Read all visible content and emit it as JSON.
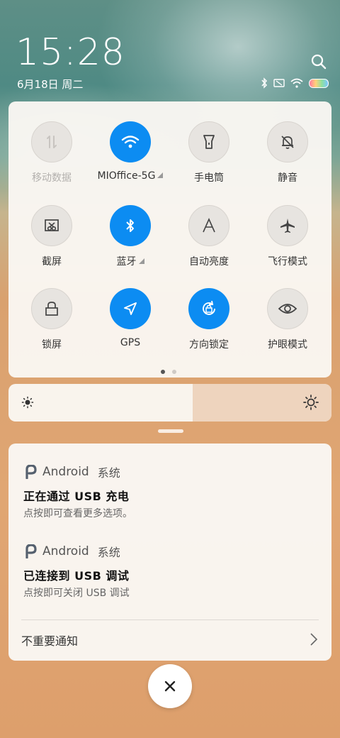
{
  "status": {
    "time": "15:28",
    "date": "6月18日 周二"
  },
  "tiles": [
    {
      "label": "移动数据",
      "icon": "mobile-data-icon",
      "on": false
    },
    {
      "label": "MIOffice-5G",
      "icon": "wifi-icon",
      "on": true
    },
    {
      "label": "手电筒",
      "icon": "flashlight-icon",
      "on": false
    },
    {
      "label": "静音",
      "icon": "mute-bell-icon",
      "on": false
    },
    {
      "label": "截屏",
      "icon": "screenshot-icon",
      "on": false
    },
    {
      "label": "蓝牙",
      "icon": "bluetooth-icon",
      "on": true
    },
    {
      "label": "自动亮度",
      "icon": "auto-brightness-icon",
      "on": false
    },
    {
      "label": "飞行模式",
      "icon": "airplane-icon",
      "on": false
    },
    {
      "label": "锁屏",
      "icon": "lock-icon",
      "on": false
    },
    {
      "label": "GPS",
      "icon": "location-arrow-icon",
      "on": true
    },
    {
      "label": "方向锁定",
      "icon": "rotation-lock-icon",
      "on": true
    },
    {
      "label": "护眼模式",
      "icon": "eye-icon",
      "on": false
    }
  ],
  "tiles_page": {
    "current": 1,
    "total": 2
  },
  "brightness": {
    "level": 0.57
  },
  "notifications": [
    {
      "app": "Android",
      "source": "系统",
      "title": "正在通过 USB 充电",
      "text": "点按即可查看更多选项。"
    },
    {
      "app": "Android",
      "source": "系统",
      "title": "已连接到 USB 调试",
      "text": "点按即可关闭 USB 调试"
    }
  ],
  "footer": {
    "label": "不重要通知"
  },
  "colors": {
    "accent": "#0c8cf2"
  }
}
